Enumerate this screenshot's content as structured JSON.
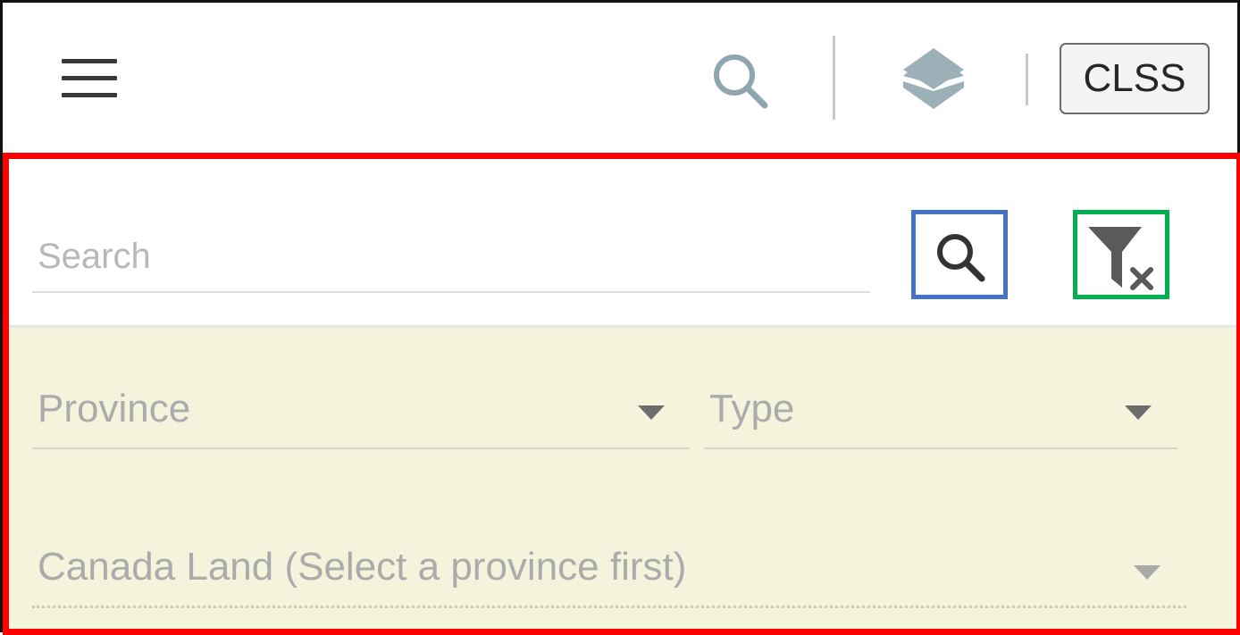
{
  "toolbar": {
    "menu_icon": "hamburger-menu-icon",
    "search_icon": "search-icon",
    "layers_icon": "layers-icon",
    "clss_button_label": "CLSS",
    "search_icon_color": "#8fa6b0",
    "layers_icon_color": "#9cb0b7"
  },
  "panel": {
    "search": {
      "placeholder": "Search",
      "search_button_icon": "search-icon",
      "clear_filter_button_icon": "clear-filter-icon"
    },
    "filters": {
      "province_label": "Province",
      "type_label": "Type",
      "canada_land_label": "Canada Land (Select a province first)",
      "background_color": "#f4f4dc"
    },
    "highlight_colors": {
      "panel": "#ff0000",
      "search_button": "#4472c4",
      "clear_filter_button": "#00b050"
    }
  }
}
